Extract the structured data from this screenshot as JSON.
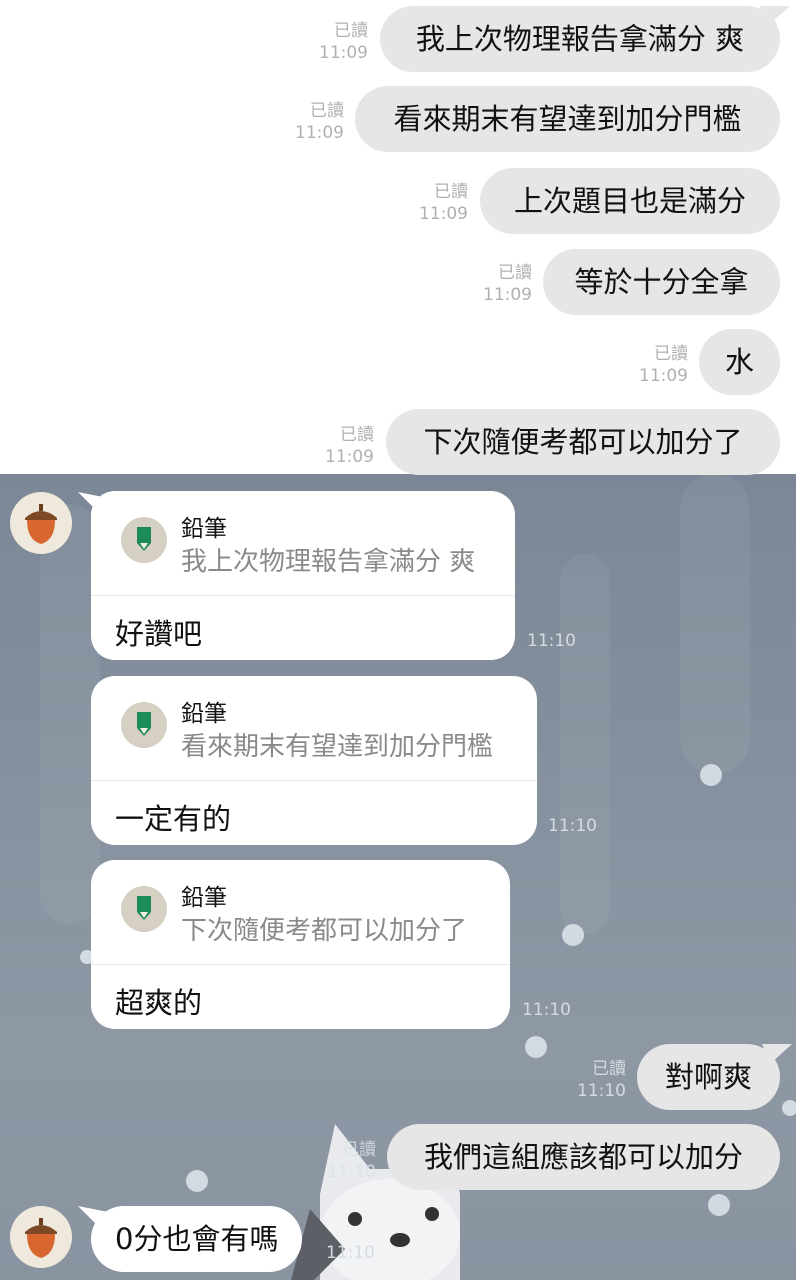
{
  "read_label": "已讀",
  "sent_messages": [
    {
      "text": "我上次物理報告拿滿分 爽",
      "time": "11:09"
    },
    {
      "text": "看來期末有望達到加分門檻",
      "time": "11:09"
    },
    {
      "text": "上次題目也是滿分",
      "time": "11:09"
    },
    {
      "text": "等於十分全拿",
      "time": "11:09"
    },
    {
      "text": "水",
      "time": "11:09"
    },
    {
      "text": "下次隨便考都可以加分了",
      "time": "11:09"
    }
  ],
  "replies": [
    {
      "quote_author": "鉛筆",
      "quote_text": "我上次物理報告拿滿分 爽",
      "text": "好讚吧",
      "time": "11:10"
    },
    {
      "quote_author": "鉛筆",
      "quote_text": "看來期末有望達到加分門檻",
      "text": "一定有的",
      "time": "11:10"
    },
    {
      "quote_author": "鉛筆",
      "quote_text": "下次隨便考都可以加分了",
      "text": "超爽的",
      "time": "11:10"
    }
  ],
  "sent_messages_2": [
    {
      "text": "對啊爽",
      "time": "11:10"
    },
    {
      "text": "我們這組應該都可以加分",
      "time": "11:10"
    }
  ],
  "last_incoming": {
    "text": "0分也會有嗎",
    "time": "11:10"
  },
  "colors": {
    "sent_bubble": "#e6e6e6",
    "chat_background": "#86919f",
    "quote_icon_green": "#1d8a5a",
    "acorn": "#d9662f"
  },
  "icons": {
    "avatar": "acorn-icon",
    "quote": "pencil-icon"
  }
}
